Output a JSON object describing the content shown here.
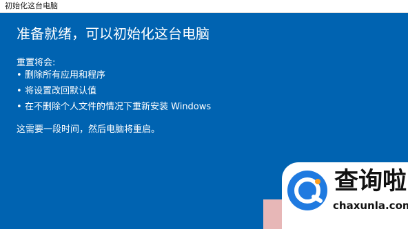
{
  "window": {
    "title": "初始化这台电脑",
    "background_color": "#0063b1"
  },
  "content": {
    "heading": "准备就绪，可以初始化这台电脑",
    "intro": "重置将会:",
    "bullets": [
      "删除所有应用和程序",
      "将设置改回默认值",
      "在不删除个人文件的情况下重新安装 Windows"
    ],
    "note": "这需要一段时间，然后电脑将重启。"
  },
  "watermark": {
    "brand": "查询啦",
    "domain": "chaxunla.com"
  }
}
